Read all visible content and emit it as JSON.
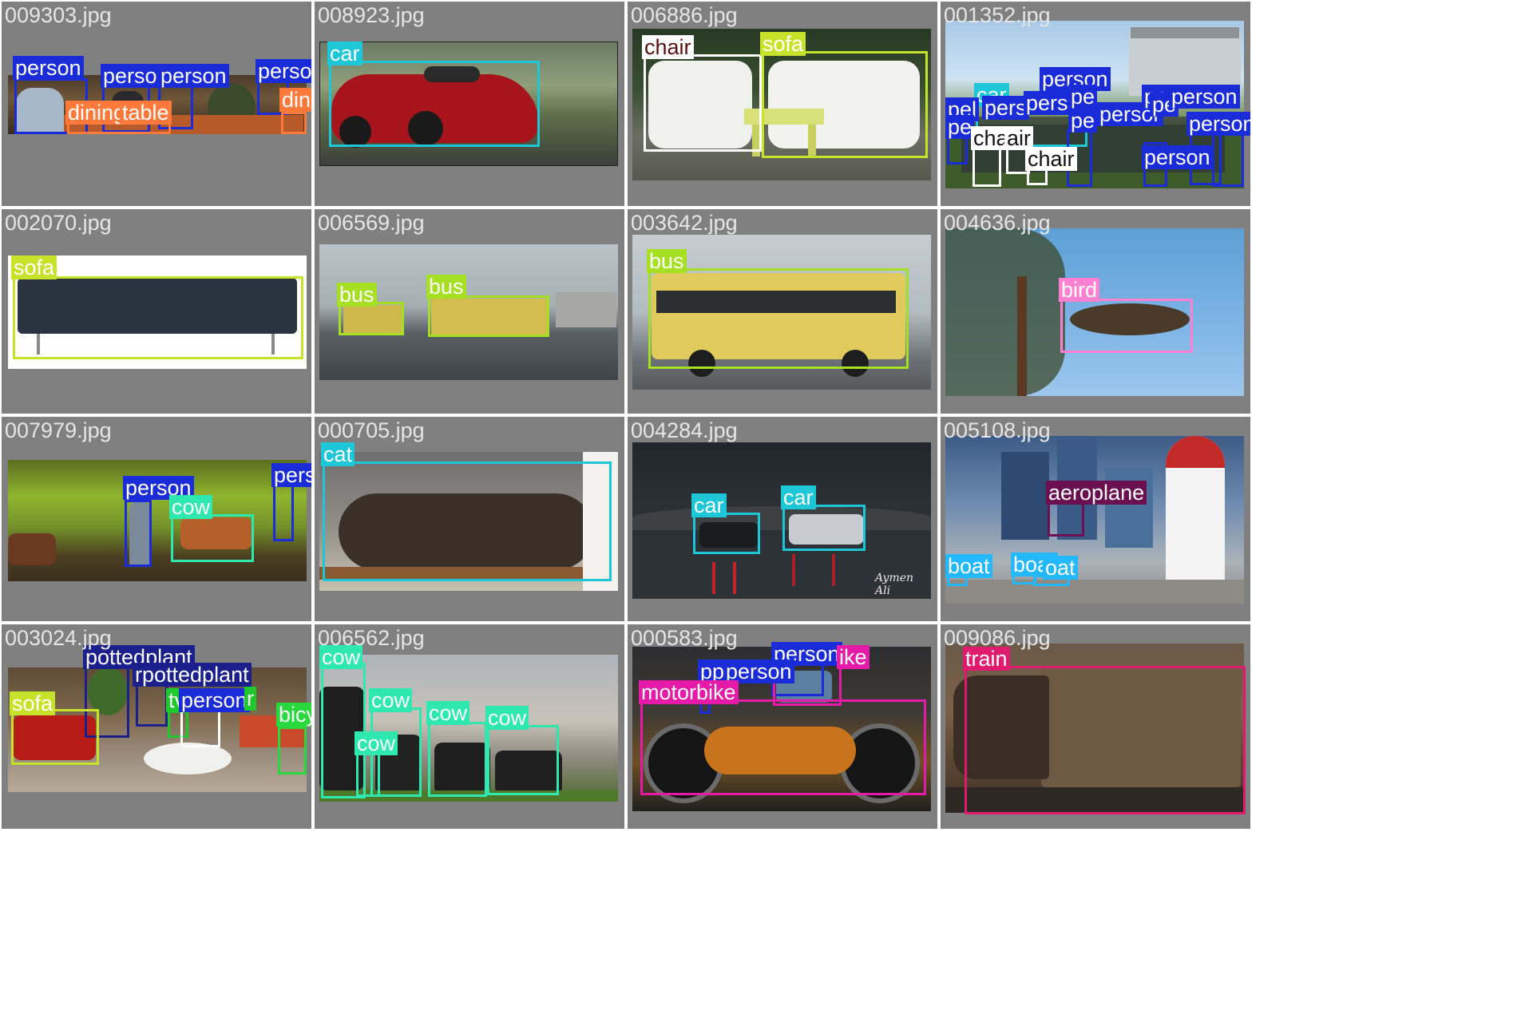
{
  "colors": {
    "person": "#1a2bd8",
    "diningtable": "#ff7a3a",
    "car": "#1ec7d8",
    "chair": "#ffffff",
    "sofa": "#c6e22b",
    "bus": "#a6e022",
    "bird": "#ff7fd0",
    "cow": "#2ee8b0",
    "cat": "#1ec7d8",
    "aeroplane": "#6a0f4f",
    "boat": "#23b8ff",
    "pottedplant": "#1a1f8c",
    "tvmonitor": "#1ec82e",
    "bicycle": "#28d83c",
    "motorbike": "#e51aa8",
    "train": "#e01a6e"
  },
  "tiles": [
    {
      "file": "009303.jpg",
      "detections": [
        {
          "label": "person",
          "cls": "person"
        },
        {
          "label": "persor",
          "cls": "person"
        },
        {
          "label": "person",
          "cls": "person"
        },
        {
          "label": "person",
          "cls": "person"
        },
        {
          "label": "dining",
          "cls": "diningtable"
        },
        {
          "label": "table",
          "cls": "diningtable"
        },
        {
          "label": "diningtable",
          "cls": "diningtable"
        }
      ]
    },
    {
      "file": "008923.jpg",
      "detections": [
        {
          "label": "car",
          "cls": "car"
        }
      ]
    },
    {
      "file": "006886.jpg",
      "detections": [
        {
          "label": "chair",
          "cls": "chair"
        },
        {
          "label": "sofa",
          "cls": "sofa"
        }
      ]
    },
    {
      "file": "001352.jpg",
      "detections": [
        {
          "label": "person",
          "cls": "person"
        },
        {
          "label": "car",
          "cls": "car"
        },
        {
          "label": "pel",
          "cls": "person"
        },
        {
          "label": "pers",
          "cls": "person"
        },
        {
          "label": "perso",
          "cls": "person"
        },
        {
          "label": "pe",
          "cls": "person"
        },
        {
          "label": "pe",
          "cls": "person"
        },
        {
          "label": "pe",
          "cls": "person"
        },
        {
          "label": "persor",
          "cls": "person"
        },
        {
          "label": "person",
          "cls": "person"
        },
        {
          "label": "pe",
          "cls": "person"
        },
        {
          "label": "person",
          "cls": "person"
        },
        {
          "label": "person",
          "cls": "person"
        },
        {
          "label": "person",
          "cls": "person"
        },
        {
          "label": "chair",
          "cls": "chair"
        },
        {
          "label": "air",
          "cls": "chair"
        },
        {
          "label": "chair",
          "cls": "chair"
        }
      ]
    },
    {
      "file": "002070.jpg",
      "detections": [
        {
          "label": "sofa",
          "cls": "sofa"
        }
      ]
    },
    {
      "file": "006569.jpg",
      "detections": [
        {
          "label": "bus",
          "cls": "bus"
        },
        {
          "label": "bus",
          "cls": "bus"
        }
      ]
    },
    {
      "file": "003642.jpg",
      "detections": [
        {
          "label": "bus",
          "cls": "bus"
        }
      ]
    },
    {
      "file": "004636.jpg",
      "detections": [
        {
          "label": "bird",
          "cls": "bird"
        }
      ]
    },
    {
      "file": "007979.jpg",
      "detections": [
        {
          "label": "person",
          "cls": "person"
        },
        {
          "label": "cow",
          "cls": "cow"
        },
        {
          "label": "person",
          "cls": "person"
        }
      ]
    },
    {
      "file": "000705.jpg",
      "detections": [
        {
          "label": "cat",
          "cls": "cat"
        }
      ]
    },
    {
      "file": "004284.jpg",
      "detections": [
        {
          "label": "car",
          "cls": "car"
        },
        {
          "label": "car",
          "cls": "car"
        }
      ],
      "watermark": "Aymen Ali"
    },
    {
      "file": "005108.jpg",
      "detections": [
        {
          "label": "aeroplane",
          "cls": "aeroplane"
        },
        {
          "label": "boat",
          "cls": "boat"
        },
        {
          "label": "boat",
          "cls": "boat"
        },
        {
          "label": "oat",
          "cls": "boat"
        }
      ]
    },
    {
      "file": "003024.jpg",
      "detections": [
        {
          "label": "pottedplant",
          "cls": "pottedplant"
        },
        {
          "label": "rpottedplant",
          "cls": "pottedplant"
        },
        {
          "label": "sofa",
          "cls": "sofa"
        },
        {
          "label": "tv",
          "cls": "tvmonitor"
        },
        {
          "label": "person",
          "cls": "person"
        },
        {
          "label": "r",
          "cls": "tvmonitor"
        },
        {
          "label": "bicycle",
          "cls": "bicycle"
        }
      ]
    },
    {
      "file": "006562.jpg",
      "detections": [
        {
          "label": "cow",
          "cls": "cow"
        },
        {
          "label": "cow",
          "cls": "cow"
        },
        {
          "label": "cow",
          "cls": "cow"
        },
        {
          "label": "cow",
          "cls": "cow"
        },
        {
          "label": "cow",
          "cls": "cow"
        }
      ]
    },
    {
      "file": "000583.jpg",
      "detections": [
        {
          "label": "person",
          "cls": "person"
        },
        {
          "label": "pp",
          "cls": "person"
        },
        {
          "label": "person",
          "cls": "person"
        },
        {
          "label": "ike",
          "cls": "motorbike"
        },
        {
          "label": "motorbike",
          "cls": "motorbike"
        }
      ]
    },
    {
      "file": "009086.jpg",
      "detections": [
        {
          "label": "train",
          "cls": "train"
        }
      ]
    }
  ]
}
